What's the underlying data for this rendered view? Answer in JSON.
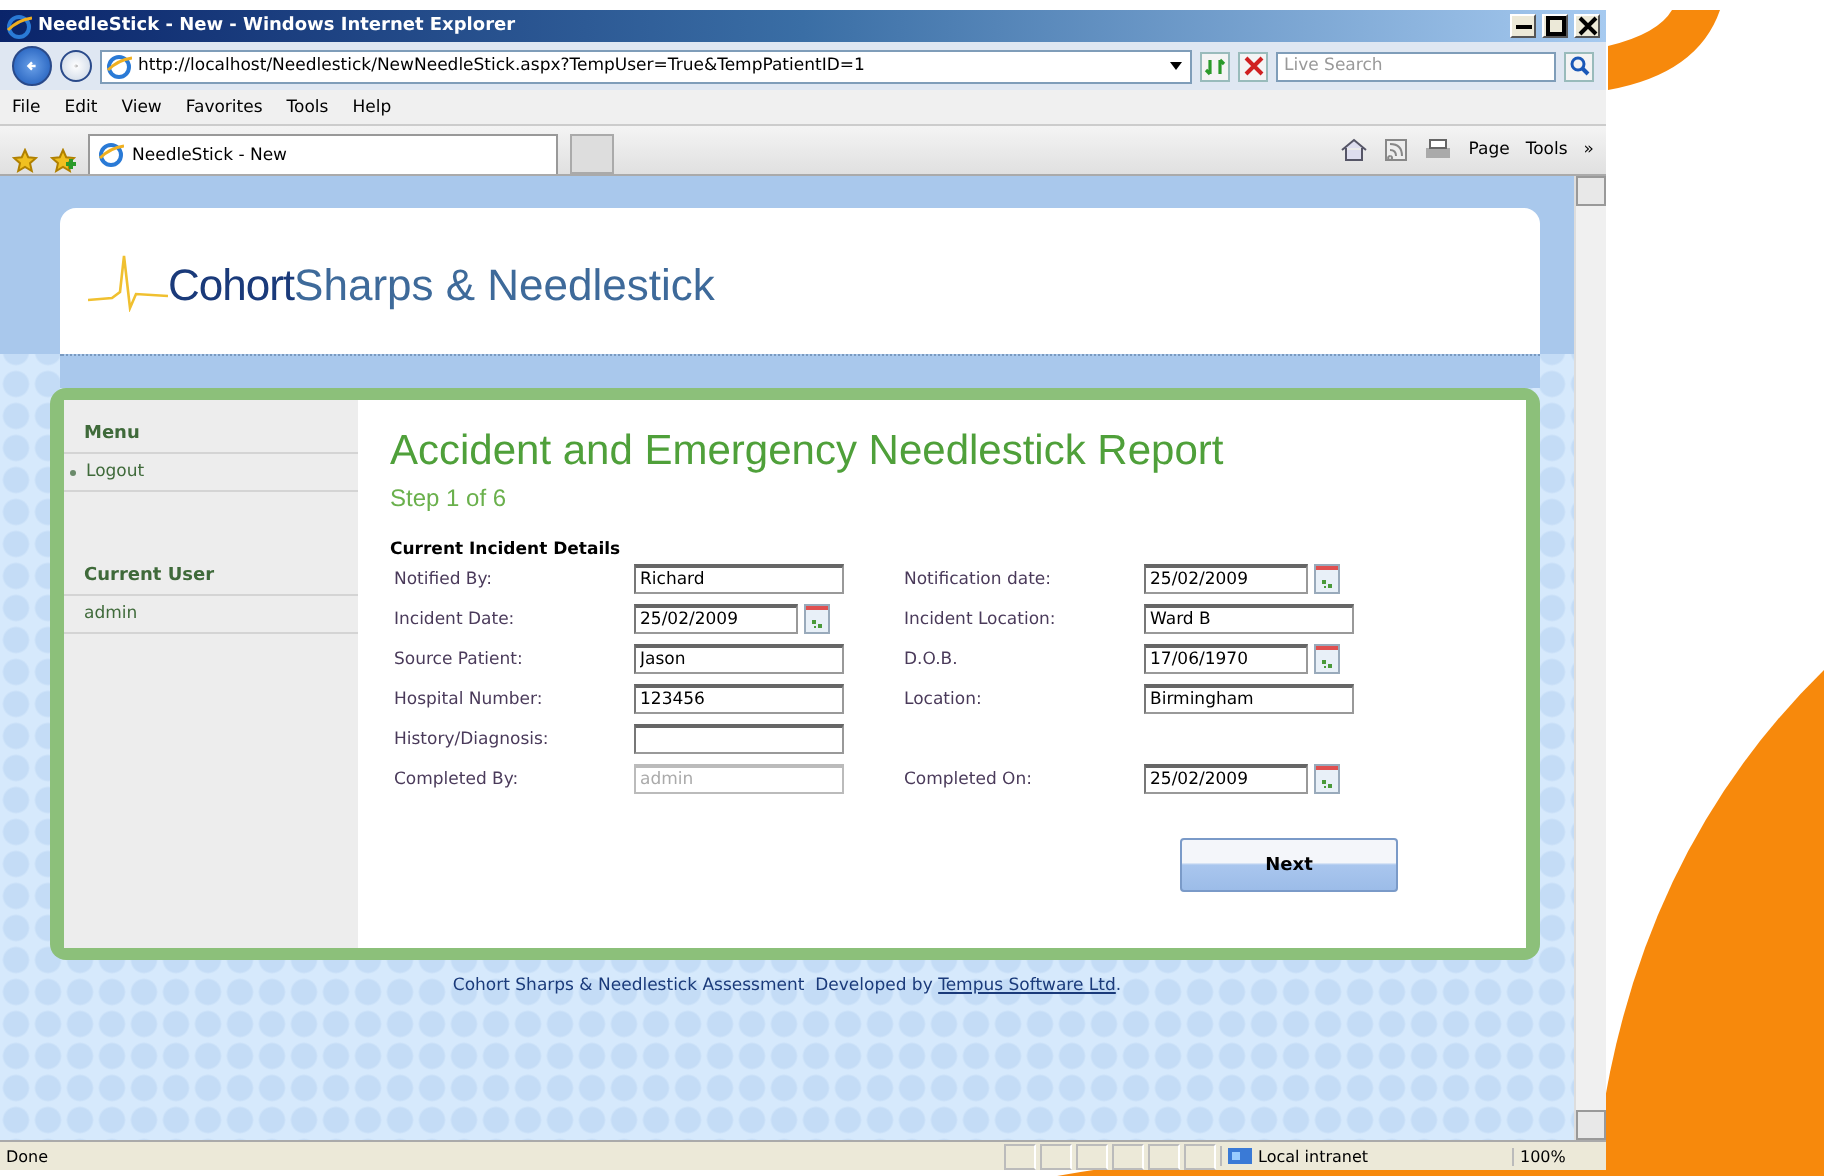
{
  "window": {
    "title": "NeedleStick - New - Windows Internet Explorer"
  },
  "address_bar": {
    "url": "http://localhost/Needlestick/NewNeedleStick.aspx?TempUser=True&TempPatientID=1"
  },
  "search": {
    "placeholder": "Live Search"
  },
  "menu_bar": [
    "File",
    "Edit",
    "View",
    "Favorites",
    "Tools",
    "Help"
  ],
  "tabs": [
    {
      "label": "NeedleStick - New",
      "selected": true
    }
  ],
  "command_bar": [
    "Page",
    "Tools",
    "»"
  ],
  "page": {
    "logo": {
      "brand": "Cohort",
      "title": "Sharps & Needlestick"
    },
    "sidebar": [
      {
        "heading": "Menu",
        "items": [
          {
            "label": "Logout",
            "kind": "link"
          }
        ]
      },
      {
        "heading": "Current User",
        "items": [
          {
            "label": "admin",
            "kind": "text"
          }
        ]
      }
    ],
    "heading": "Accident and Emergency Needlestick Report",
    "step": "Step 1 of 6",
    "section": "Current Incident Details",
    "rows": [
      {
        "left": {
          "label": "Notified By:",
          "value": "Richard",
          "kind": "text",
          "disabled": false
        },
        "right": {
          "label": "Notification date:",
          "value": "25/02/2009",
          "kind": "date",
          "disabled": false
        }
      },
      {
        "left": {
          "label": "Incident Date:",
          "value": "25/02/2009",
          "kind": "date",
          "disabled": false
        },
        "right": {
          "label": "Incident Location:",
          "value": "Ward B",
          "kind": "text",
          "disabled": false
        }
      },
      {
        "left": {
          "label": "Source Patient:",
          "value": "Jason",
          "kind": "text",
          "disabled": false
        },
        "right": {
          "label": "D.O.B.",
          "value": "17/06/1970",
          "kind": "date",
          "disabled": false
        }
      },
      {
        "left": {
          "label": "Hospital Number:",
          "value": "123456",
          "kind": "text",
          "disabled": false
        },
        "right": {
          "label": "Location:",
          "value": "Birmingham",
          "kind": "text",
          "disabled": false
        }
      },
      {
        "left": {
          "label": "History/Diagnosis:",
          "kind": "text",
          "disabled": false
        }
      },
      {
        "left": {
          "label": "Completed By:",
          "value": "admin",
          "kind": "text",
          "disabled": true
        },
        "right": {
          "label": "Completed On:",
          "value": "25/02/2009",
          "kind": "date",
          "disabled": false
        }
      }
    ],
    "next_button": "Next",
    "footer": {
      "text": "Cohort Sharps & Needlestick Assessment  Developed by ",
      "link": "Tempus Software Ltd",
      "suffix": "."
    }
  },
  "status_bar": {
    "text": "Done",
    "zone": "Local intranet",
    "zoom": "100%"
  }
}
